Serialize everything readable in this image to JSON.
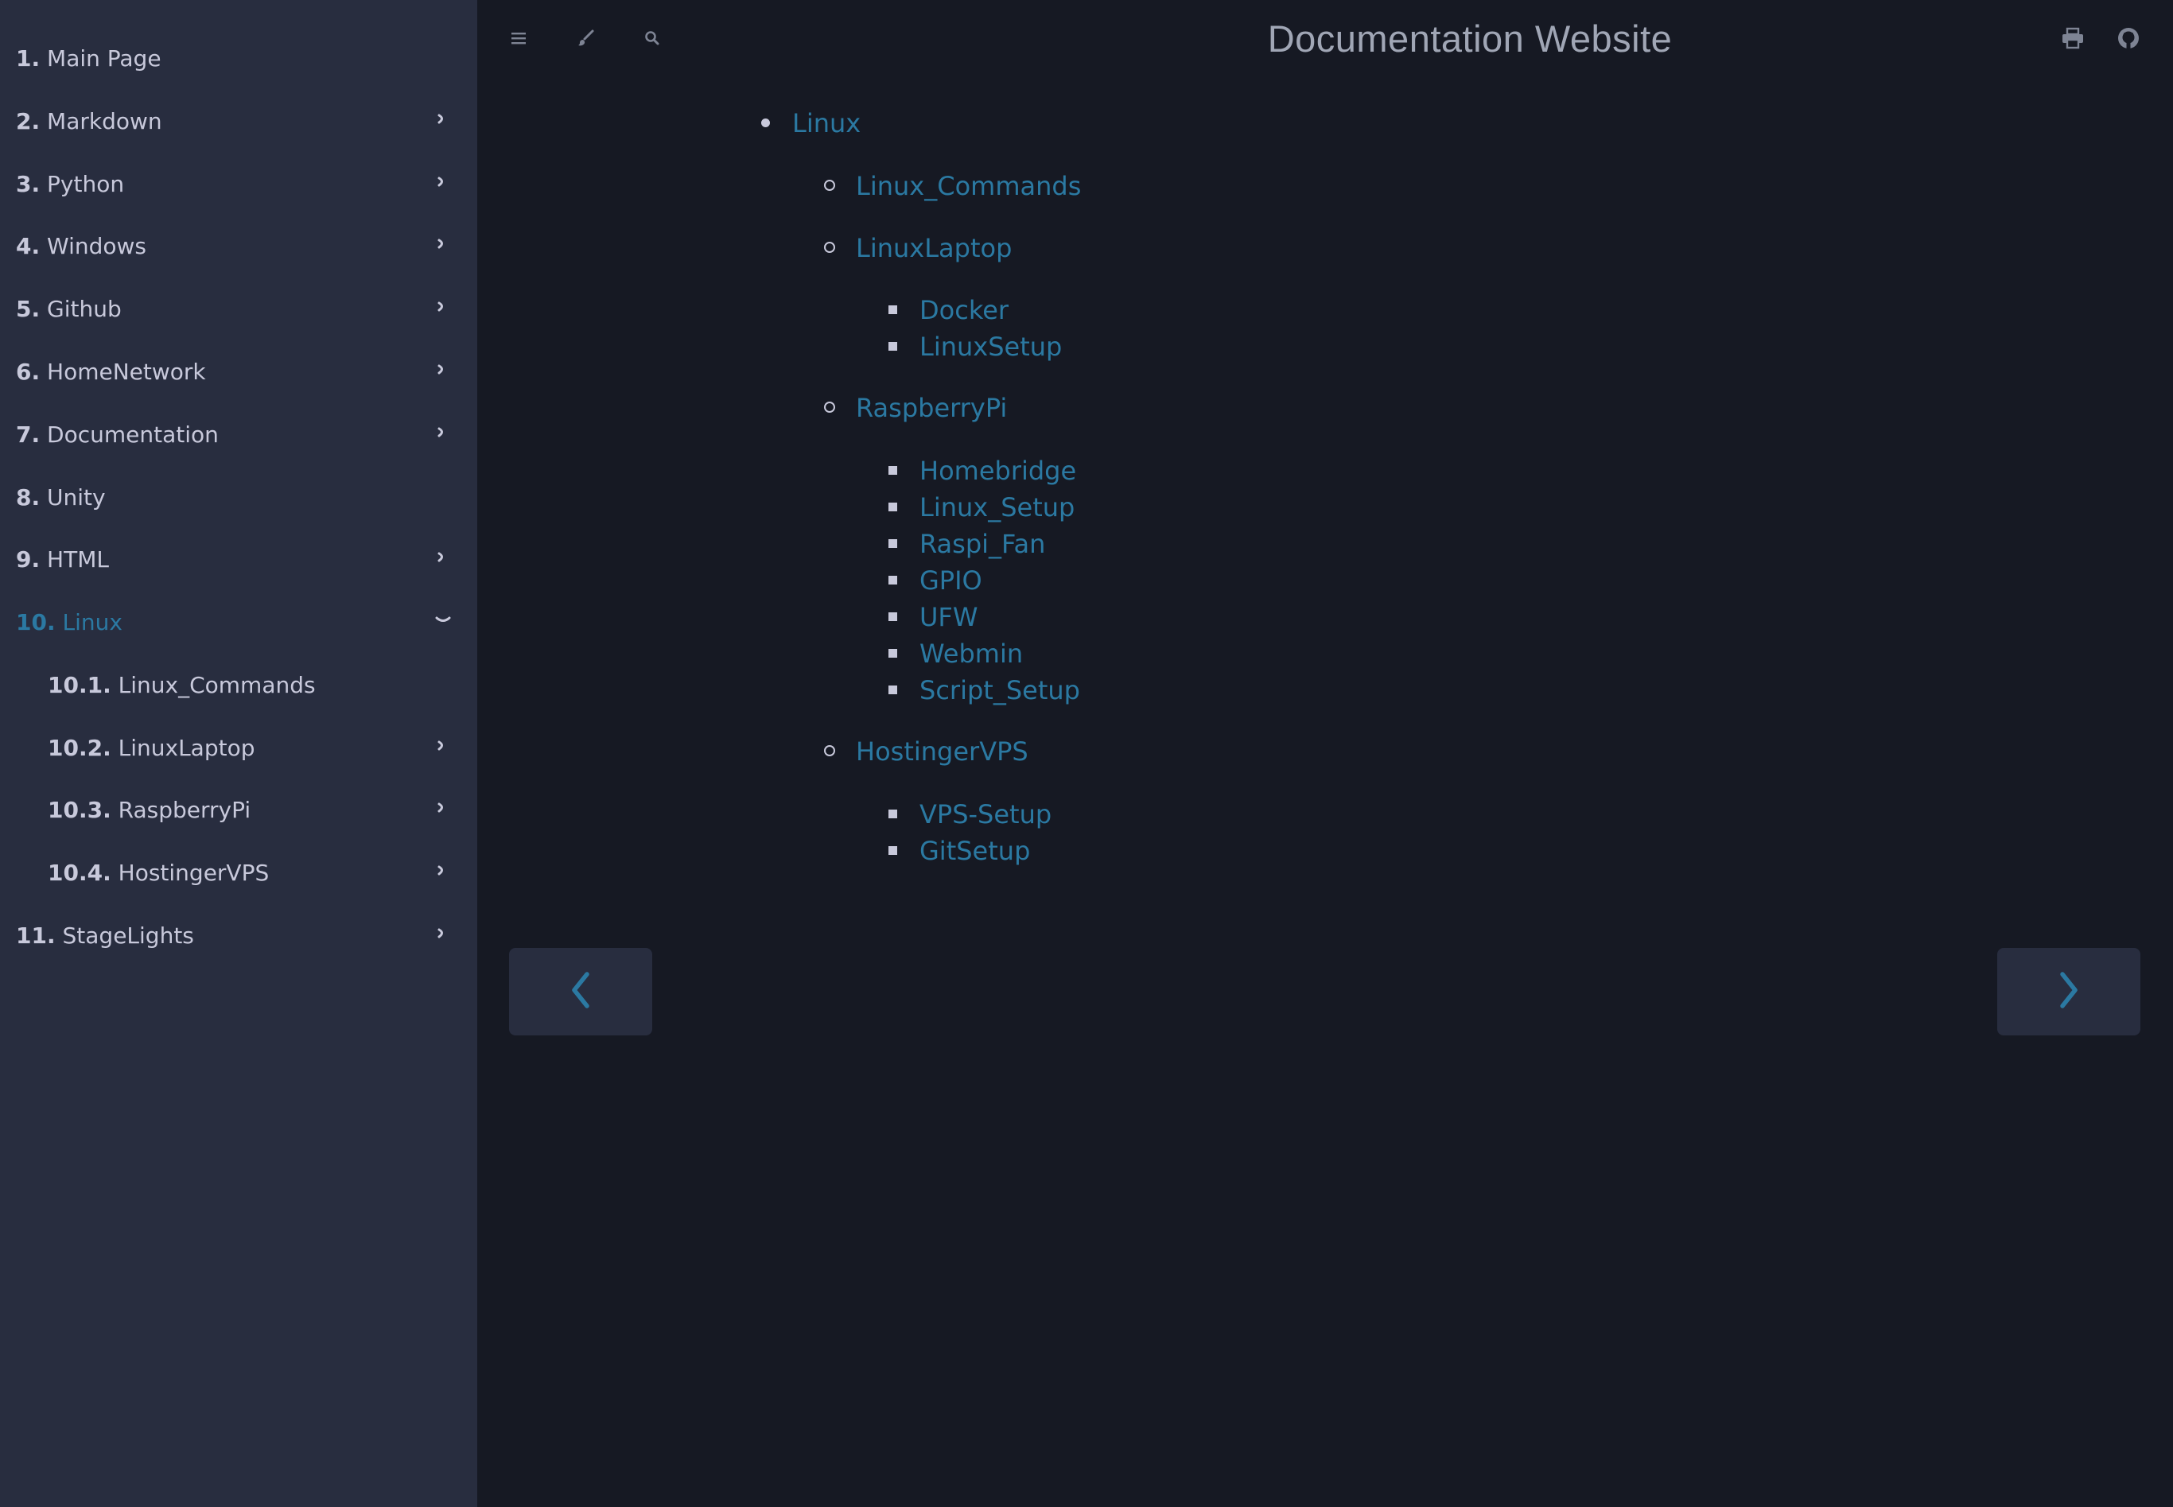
{
  "header": {
    "title": "Documentation Website",
    "icons": [
      "menu-icon",
      "paintbrush-icon",
      "search-icon",
      "print-icon",
      "github-icon"
    ]
  },
  "colors": {
    "sidebar_bg": "#282d3f",
    "main_bg": "#161923",
    "link": "#2b79a2",
    "sidebar_text": "#c8c9db",
    "title": "#a0a6b5"
  },
  "sidebar": {
    "items": [
      {
        "num": "1.",
        "label": "Main Page"
      },
      {
        "num": "2.",
        "label": "Markdown"
      },
      {
        "num": "3.",
        "label": "Python"
      },
      {
        "num": "4.",
        "label": "Windows"
      },
      {
        "num": "5.",
        "label": "Github"
      },
      {
        "num": "6.",
        "label": "HomeNetwork"
      },
      {
        "num": "7.",
        "label": "Documentation"
      },
      {
        "num": "8.",
        "label": "Unity"
      },
      {
        "num": "9.",
        "label": "HTML"
      },
      {
        "num": "10.",
        "label": "Linux"
      },
      {
        "num": "10.1.",
        "label": "Linux_Commands"
      },
      {
        "num": "10.2.",
        "label": "LinuxLaptop"
      },
      {
        "num": "10.3.",
        "label": "RaspberryPi"
      },
      {
        "num": "10.4.",
        "label": "HostingerVPS"
      },
      {
        "num": "11.",
        "label": "StageLights"
      }
    ],
    "active_item": "10. Linux"
  },
  "content": {
    "toc": {
      "root": "Linux",
      "linux_commands": "Linux_Commands",
      "linuxlaptop": "LinuxLaptop",
      "docker": "Docker",
      "linuxsetup": "LinuxSetup",
      "raspberrypi": "RaspberryPi",
      "homebridge": "Homebridge",
      "linux_setup": "Linux_Setup",
      "raspi_fan": "Raspi_Fan",
      "gpio": "GPIO",
      "ufw": "UFW",
      "webmin": "Webmin",
      "script_setup": "Script_Setup",
      "hostingervps": "HostingerVPS",
      "vps_setup": "VPS-Setup",
      "gitsetup": "GitSetup"
    }
  },
  "navigation": {
    "previous_icon": "chevron-left-icon",
    "next_icon": "chevron-right-icon"
  }
}
